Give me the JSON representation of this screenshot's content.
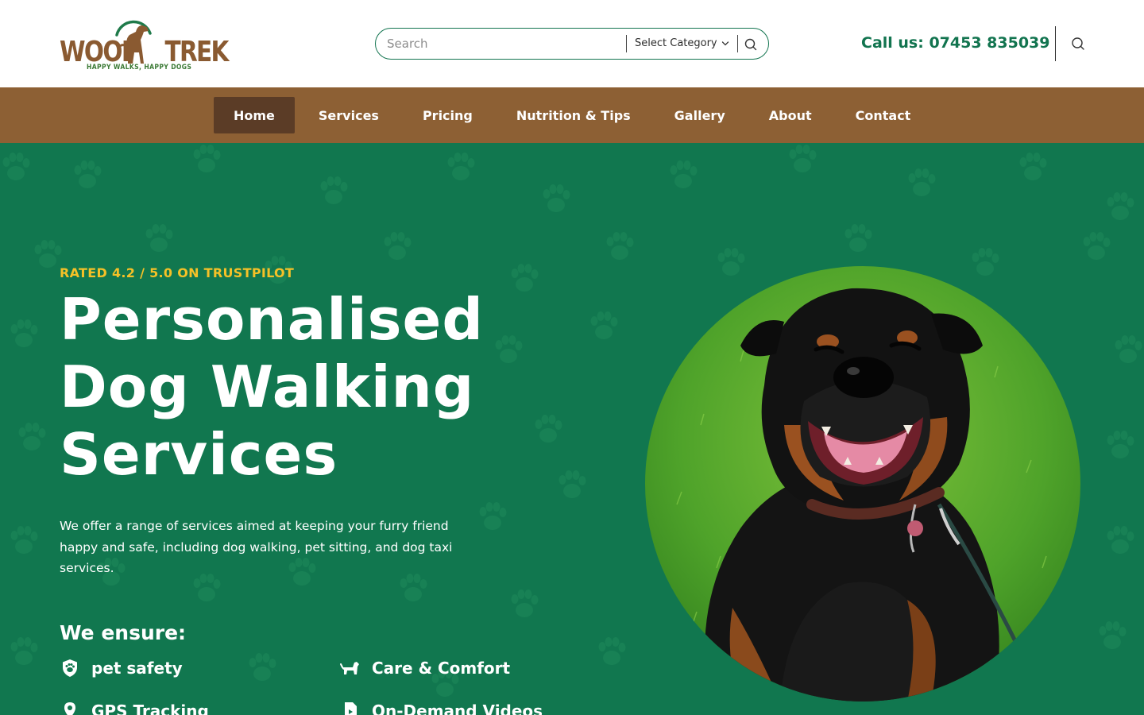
{
  "header": {
    "logo": {
      "wordmark_left": "WOOF",
      "wordmark_right": "TREK",
      "tagline": "HAPPY WALKS, HAPPY DOGS",
      "icon": "dog-silhouette-icon"
    },
    "search": {
      "placeholder": "Search",
      "category_selected": "Select Category",
      "icon": "search-icon"
    },
    "phone_text": "Call us: 07453 835039",
    "search_toggle_icon": "search-icon"
  },
  "nav": {
    "items": [
      {
        "label": "Home",
        "active": true
      },
      {
        "label": "Services",
        "active": false
      },
      {
        "label": "Pricing",
        "active": false
      },
      {
        "label": "Nutrition & Tips",
        "active": false
      },
      {
        "label": "Gallery",
        "active": false
      },
      {
        "label": "About",
        "active": false
      },
      {
        "label": "Contact",
        "active": false
      }
    ]
  },
  "hero": {
    "rating": "RATED 4.2 / 5.0 ON TRUSTPILOT",
    "headline_line1": "Personalised",
    "headline_line2": "Dog Walking",
    "headline_line3": "Services",
    "intro": "We offer a range of services aimed at keeping your furry friend happy and safe, including dog walking, pet sitting, and dog taxi services.",
    "ensure_title": "We ensure:",
    "features": [
      {
        "label": "pet safety",
        "icon": "shield-paw-icon"
      },
      {
        "label": "Care & Comfort",
        "icon": "dog-icon"
      },
      {
        "label": "GPS Tracking",
        "icon": "map-pin-icon"
      },
      {
        "label": "On-Demand Videos",
        "icon": "video-file-icon"
      }
    ],
    "image": "rottweiler-photo"
  },
  "colors": {
    "brand_green": "#11774f",
    "brand_brown": "#8d6034",
    "nav_active": "#5b3c26",
    "accent_yellow": "#f5c127"
  }
}
